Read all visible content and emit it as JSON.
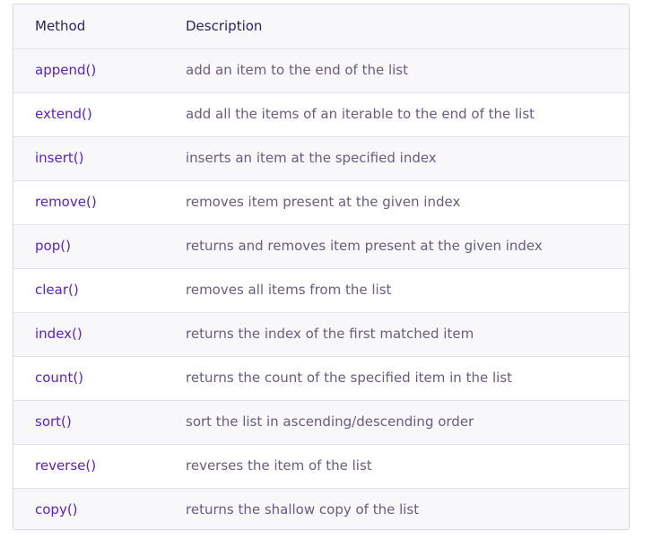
{
  "table": {
    "headers": {
      "method": "Method",
      "description": "Description"
    },
    "rows": [
      {
        "method": "append()",
        "description": "add an item to the end of the list"
      },
      {
        "method": "extend()",
        "description": "add all the items of an iterable to the end of the list"
      },
      {
        "method": "insert()",
        "description": "inserts an item at the specified index"
      },
      {
        "method": "remove()",
        "description": "removes item present at the given index"
      },
      {
        "method": "pop()",
        "description": "returns and removes item present at the given index"
      },
      {
        "method": "clear()",
        "description": "removes all items from the list"
      },
      {
        "method": "index()",
        "description": "returns the index of the first matched item"
      },
      {
        "method": "count()",
        "description": "returns the count of the specified item in the list"
      },
      {
        "method": "sort()",
        "description": "sort the list in ascending/descending order"
      },
      {
        "method": "reverse()",
        "description": "reverses the item of the list"
      },
      {
        "method": "copy()",
        "description": "returns the shallow copy of the list"
      }
    ]
  },
  "colors": {
    "method_link": "#5a22c4",
    "description_text": "#6a5b80",
    "header_text": "#25265e",
    "border": "#d7d7e3"
  }
}
